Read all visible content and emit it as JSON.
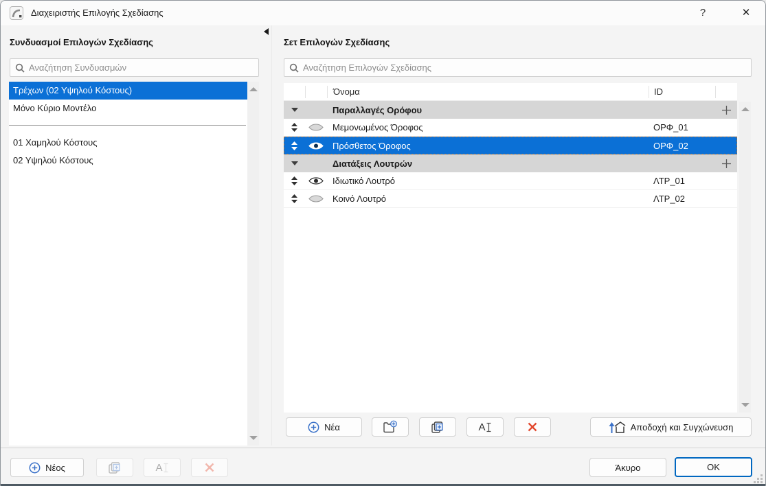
{
  "window": {
    "title": "Διαχειριστής Επιλογής Σχεδίασης",
    "help": "?",
    "close": "✕"
  },
  "left_panel": {
    "title": "Συνδυασμοί Επιλογών Σχεδίασης",
    "search_placeholder": "Αναζήτηση Συνδυασμών",
    "items": [
      {
        "label": "Τρέχων (02 Υψηλού Κόστους)",
        "selected": true
      },
      {
        "label": "Μόνο Κύριο Μοντέλο",
        "selected": false
      },
      {
        "label": "01 Χαμηλού Κόστους",
        "selected": false
      },
      {
        "label": "02 Υψηλού Κόστους",
        "selected": false
      }
    ],
    "buttons": {
      "new": "Νέος"
    }
  },
  "right_panel": {
    "title": "Σετ Επιλογών Σχεδίασης",
    "search_placeholder": "Αναζήτηση Επιλογών Σχεδίασης",
    "table": {
      "columns": {
        "name": "Όνομα",
        "id": "ID"
      },
      "groups": [
        {
          "label": "Παραλλαγές Ορόφου",
          "rows": [
            {
              "name": "Μεμονωμένος Όροφος",
              "id": "ΟΡΦ_01",
              "visible": false,
              "selected": false
            },
            {
              "name": "Πρόσθετος Όροφος",
              "id": "ΟΡΦ_02",
              "visible": true,
              "selected": true
            }
          ]
        },
        {
          "label": "Διατάξεις Λουτρών",
          "rows": [
            {
              "name": "Ιδιωτικό Λουτρό",
              "id": "ΛΤΡ_01",
              "visible": true,
              "selected": false
            },
            {
              "name": "Κοινό Λουτρό",
              "id": "ΛΤΡ_02",
              "visible": false,
              "selected": false
            }
          ]
        }
      ]
    },
    "buttons": {
      "new": "Νέα",
      "accept_merge": "Αποδοχή και Συγχώνευση"
    }
  },
  "footer": {
    "cancel": "Άκυρο",
    "ok": "OK"
  },
  "colors": {
    "selection_blue": "#0b70d6",
    "group_row_gray": "#d6d6d6",
    "delete_red": "#e2492f",
    "accent_blue": "#3b72c9",
    "dialog_bg": "#f4f4f4"
  }
}
